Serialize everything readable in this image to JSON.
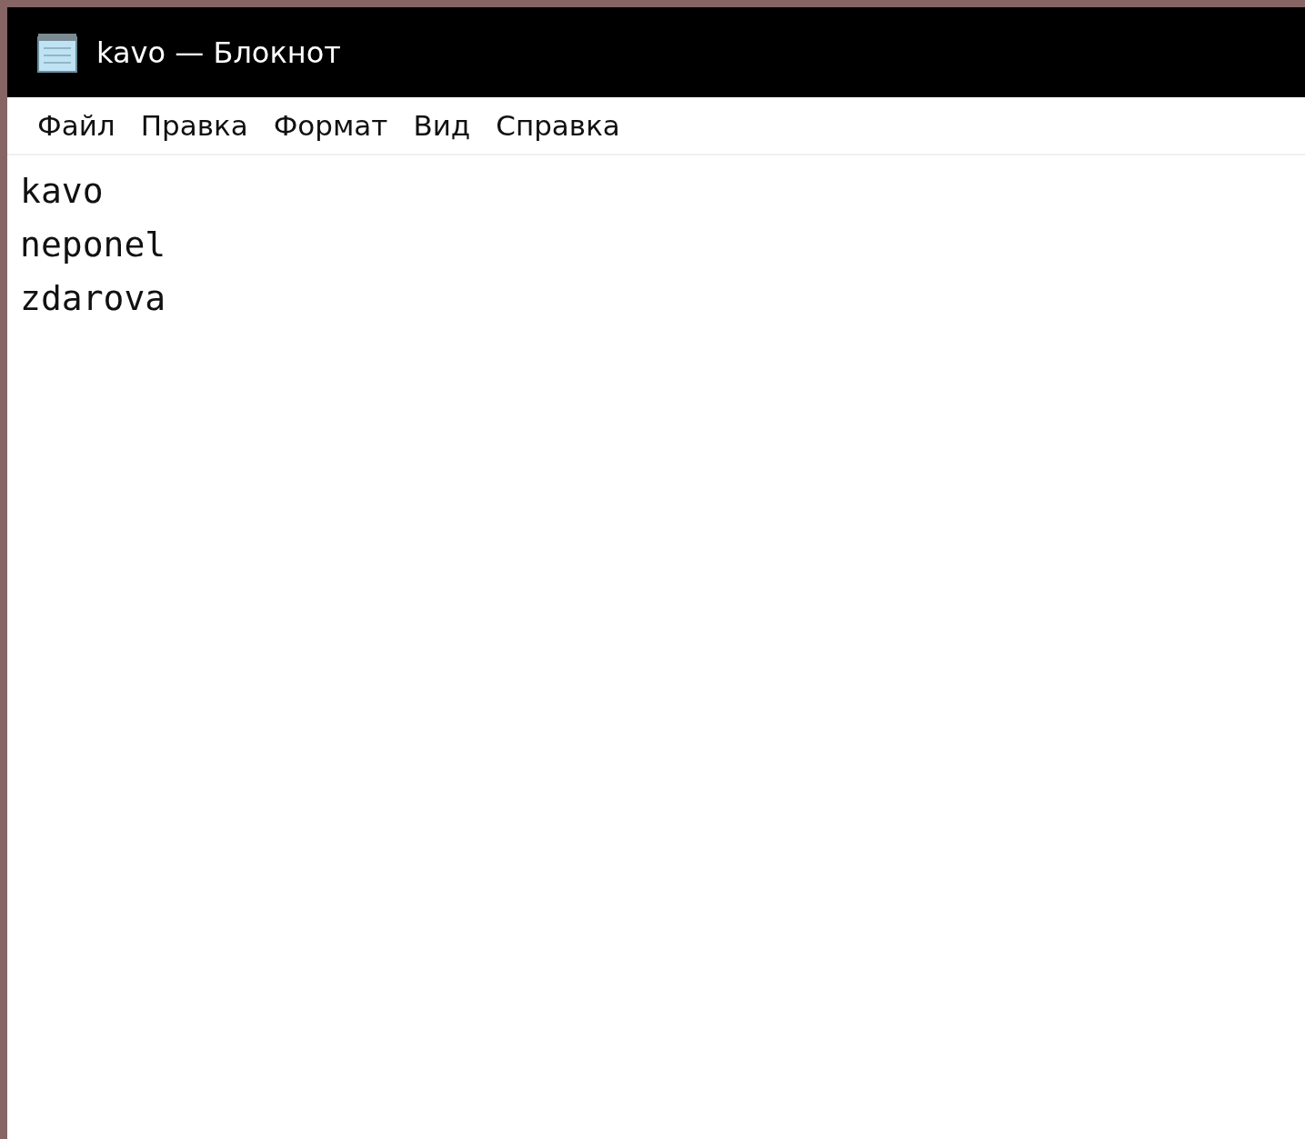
{
  "window": {
    "title": "kavo — Блокнот"
  },
  "menu": [
    {
      "label": "Файл"
    },
    {
      "label": "Правка"
    },
    {
      "label": "Формат"
    },
    {
      "label": "Вид"
    },
    {
      "label": "Справка"
    }
  ],
  "editor": {
    "lines": [
      "kavo",
      "neponel",
      "zdarova"
    ]
  }
}
